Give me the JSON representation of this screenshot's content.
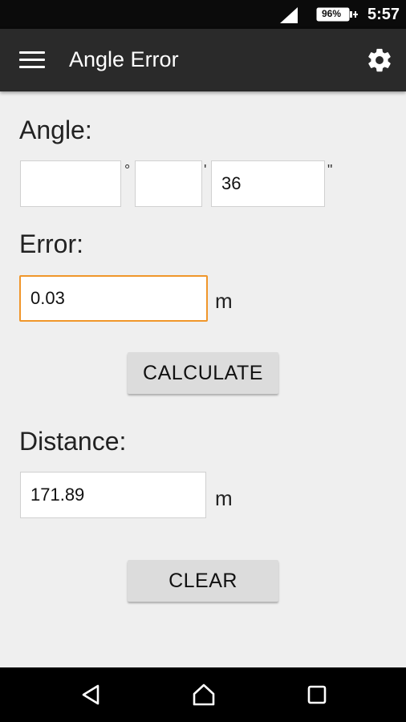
{
  "status_bar": {
    "battery": "96%",
    "time": "5:57",
    "icons": [
      "signal-icon",
      "battery-icon"
    ]
  },
  "app_bar": {
    "title": "Angle Error",
    "menu_icon": "menu-icon",
    "settings_icon": "gear-icon"
  },
  "angle": {
    "label": "Angle:",
    "degrees": {
      "value": "",
      "symbol": "°"
    },
    "minutes": {
      "value": "",
      "symbol": "'"
    },
    "seconds": {
      "value": "36",
      "symbol": "\""
    }
  },
  "error": {
    "label": "Error:",
    "value": "0.03",
    "unit": "m"
  },
  "calculate_label": "CALCULATE",
  "distance": {
    "label": "Distance:",
    "value": "171.89",
    "unit": "m"
  },
  "clear_label": "CLEAR",
  "nav_bar": {
    "icons": [
      "back-icon",
      "home-icon",
      "recent-apps-icon"
    ]
  },
  "colors": {
    "app_bar": "#2a2a2a",
    "background": "#efefef",
    "focus_accent": "#f0962a",
    "button": "#dcdcdc"
  }
}
